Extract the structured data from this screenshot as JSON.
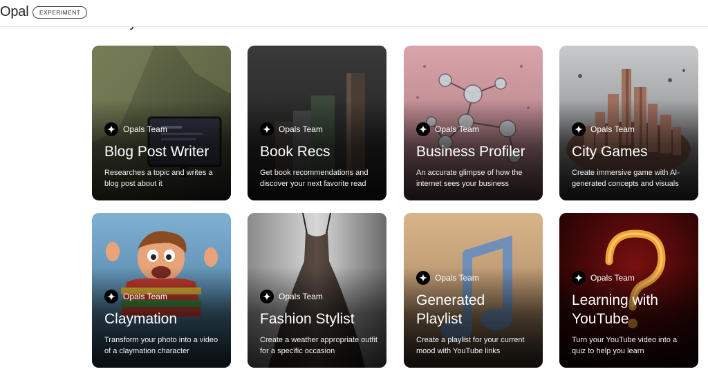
{
  "header": {
    "logo": "Opal",
    "badge": "EXPERIMENT"
  },
  "section": {
    "title": "Gallery"
  },
  "cards": [
    {
      "author": "Opals Team",
      "title": "Blog Post Writer",
      "description": "Researches a topic and writes a blog post about it"
    },
    {
      "author": "Opals Team",
      "title": "Book Recs",
      "description": "Get book recommendations and discover your next favorite read"
    },
    {
      "author": "Opals Team",
      "title": "Business Profiler",
      "description": "An accurate glimpse of how the internet sees your business"
    },
    {
      "author": "Opals Team",
      "title": "City Games",
      "description": "Create immersive game with AI-generated concepts and visuals"
    },
    {
      "author": "Opals Team",
      "title": "Claymation",
      "description": "Transform your photo into a video of a claymation character"
    },
    {
      "author": "Opals Team",
      "title": "Fashion Stylist",
      "description": "Create a weather appropriate outfit for a specific occasion"
    },
    {
      "author": "Opals Team",
      "title": "Generated Playlist",
      "description": "Create a playlist for your current mood with YouTube links"
    },
    {
      "author": "Opals Team",
      "title": "Learning with YouTube",
      "description": "Turn your YouTube video into a quiz to help you learn"
    }
  ]
}
